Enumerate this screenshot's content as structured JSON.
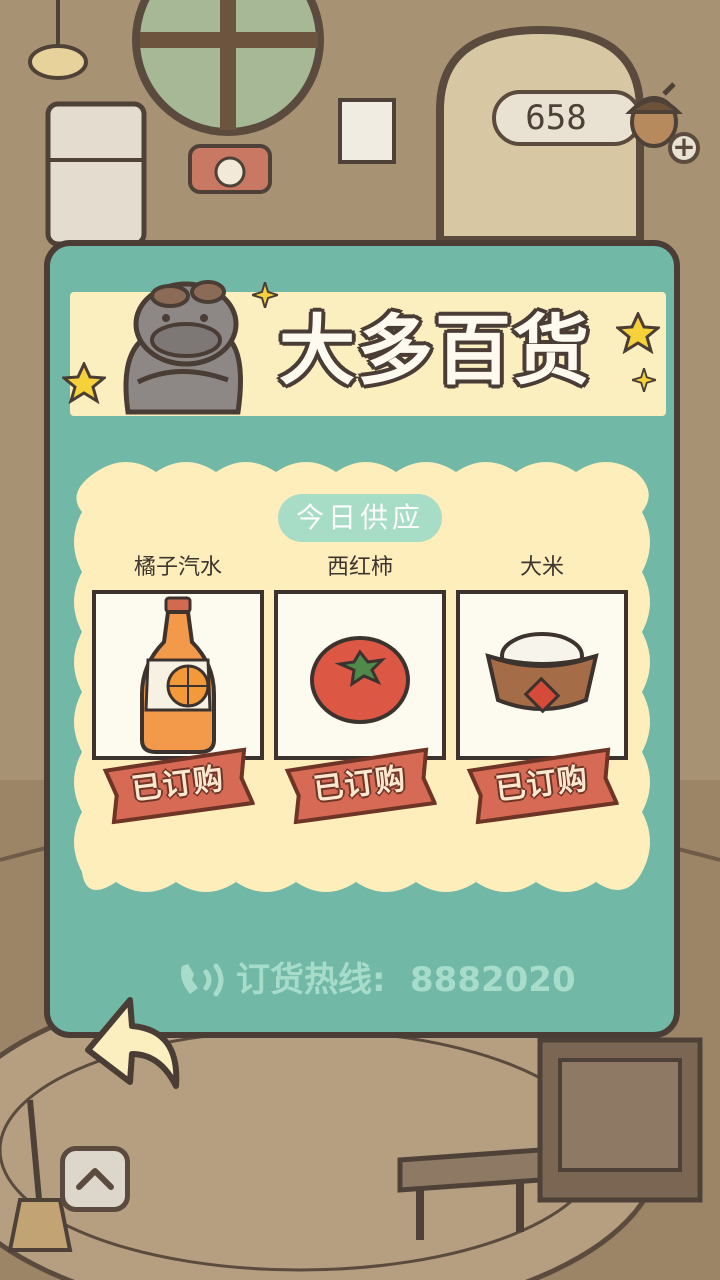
{
  "currency": {
    "amount": "658"
  },
  "shop": {
    "title": "大多百货",
    "supply_header": "今日供应",
    "items": [
      {
        "name": "橘子汽水",
        "icon": "orange-soda-icon",
        "status": "已订购"
      },
      {
        "name": "西红柿",
        "icon": "tomato-icon",
        "status": "已订购"
      },
      {
        "name": "大米",
        "icon": "rice-icon",
        "status": "已订购"
      }
    ],
    "hotline_label": "订货热线:",
    "hotline_number": "8882020"
  },
  "colors": {
    "panel": "#71b8a6",
    "banner": "#fbeebf",
    "supply_box": "#fdeebb",
    "tag": "#d66a55",
    "outline": "#4a3d36"
  }
}
